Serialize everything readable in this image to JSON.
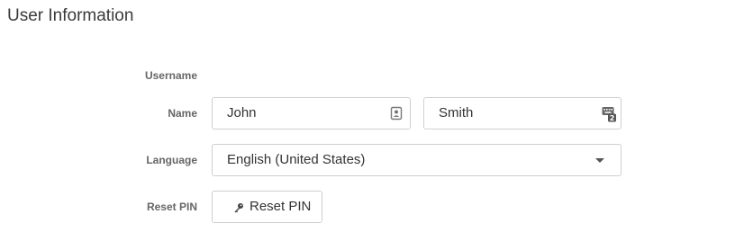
{
  "section": {
    "title": "User Information"
  },
  "fields": {
    "username": {
      "label": "Username"
    },
    "name": {
      "label": "Name",
      "first_value": "John",
      "last_value": "Smith",
      "first_icon": "contact-card-icon",
      "last_icon": "autofill-keyboard-icon"
    },
    "language": {
      "label": "Language",
      "selected": "English (United States)",
      "icon": "chevron-down-icon"
    },
    "reset_pin": {
      "label": "Reset PIN",
      "button_label": "Reset PIN",
      "icon": "key-icon"
    }
  }
}
